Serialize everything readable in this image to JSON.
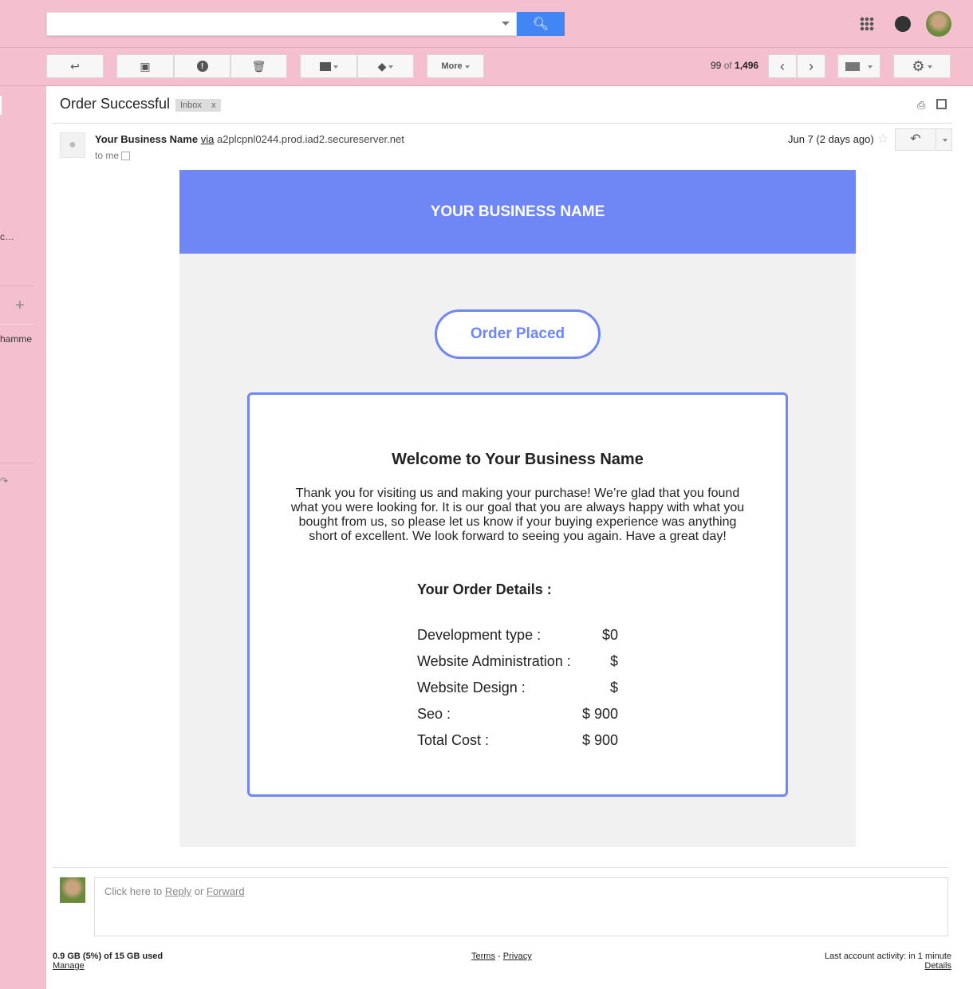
{
  "toolbar": {
    "more_label": "More",
    "pagination": "99 of 1,496",
    "pagination_current": "99",
    "pagination_of": " of ",
    "pagination_total": "1,496"
  },
  "sidebar": {
    "item1": "c…",
    "item2": "hamme"
  },
  "email": {
    "subject": "Order Successful",
    "label": "Inbox",
    "label_remove": "x",
    "sender_name": "Your Business Name",
    "via": "via",
    "sender_domain": "a2plcpnl0244.prod.iad2.secureserver.net",
    "to": "to me",
    "date": "Jun 7 (2 days ago)"
  },
  "content": {
    "business_name": "YOUR BUSINESS NAME",
    "order_placed": "Order Placed",
    "welcome": "Welcome to Your Business Name",
    "paragraph": "Thank you for visiting us and making your purchase! We’re glad that you found what you were looking for. It is our goal that you are always happy with what you bought from us, so please let us know if your buying experience was anything short of excellent. We look forward to seeing you again. Have a great day!",
    "order_details_title": "Your Order Details :",
    "order_rows": [
      {
        "label": "Development type :",
        "value": "$0"
      },
      {
        "label": "Website Administration :",
        "value": "$"
      },
      {
        "label": "Website Design :",
        "value": "$"
      },
      {
        "label": "Seo :",
        "value": "$ 900"
      },
      {
        "label": "Total Cost :",
        "value": "$ 900"
      }
    ]
  },
  "reply": {
    "prefix": "Click here to ",
    "reply": "Reply",
    "or": " or ",
    "forward": "Forward"
  },
  "footer": {
    "storage": "0.9 GB (5%) of 15 GB used",
    "manage": "Manage",
    "terms": "Terms",
    "dash": " - ",
    "privacy": "Privacy",
    "activity": "Last account activity: in 1 minute",
    "details": "Details"
  },
  "colors": {
    "accent": "#6f86f5",
    "background": "#f4bfcf",
    "search": "#4285f4"
  }
}
